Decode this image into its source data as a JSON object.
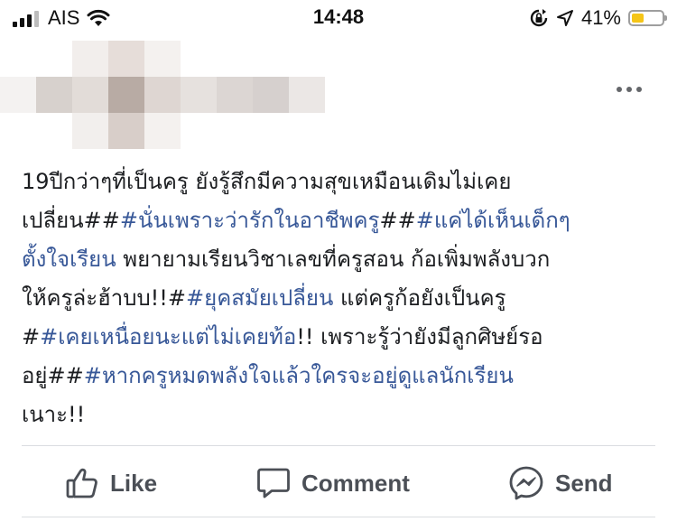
{
  "status_bar": {
    "carrier": "AIS",
    "time": "14:48",
    "battery_percent": "41%",
    "battery_level": 0.41,
    "signal_bars": 3,
    "signal_total": 4,
    "icons": [
      "signal-icon",
      "wifi-icon",
      "rotation-lock-icon",
      "location-arrow-icon",
      "battery-icon"
    ],
    "battery_color": "#f5c518"
  },
  "post": {
    "author_avatar": "blurred",
    "more_icon": "more-horizontal-icon",
    "lines": [
      [
        {
          "text": "19ปีกว่าๆที่เป็นครู ยังรู้สึกมีความสุขเหมือนเดิมไม่เคย",
          "tag": false
        }
      ],
      [
        {
          "text": "เปลี่ยน##",
          "tag": false
        },
        {
          "text": "#นั่นเพราะว่ารักในอาชีพครู",
          "tag": true
        },
        {
          "text": "##",
          "tag": false
        },
        {
          "text": "#แค่ได้เห็นเด็กๆ",
          "tag": true
        }
      ],
      [
        {
          "text": "ตั้งใจเรียน",
          "tag": true
        },
        {
          "text": " พยายามเรียนวิชาเลขที่ครูสอน ก้อเพิ่มพลังบวก",
          "tag": false
        }
      ],
      [
        {
          "text": "ให้ครูล่ะฮ้าบบ!!#",
          "tag": false
        },
        {
          "text": "#ยุคสมัยเปลี่ยน",
          "tag": true
        },
        {
          "text": " แต่ครูก้อยังเป็นครู",
          "tag": false
        }
      ],
      [
        {
          "text": "#",
          "tag": false
        },
        {
          "text": "#เคยเหนื่อยนะแต่ไม่เคยท้อ",
          "tag": true
        },
        {
          "text": "!! เพราะรู้ว่ายังมีลูกศิษย์รอ",
          "tag": false
        }
      ],
      [
        {
          "text": "อยู่##",
          "tag": false
        },
        {
          "text": "#หากครูหมดพลังใจแล้วใครจะอยู่ดูแลนักเรียน",
          "tag": true
        }
      ],
      [
        {
          "text": "เนาะ!!",
          "tag": false
        }
      ]
    ],
    "hashtag_color": "#385898"
  },
  "actions": [
    {
      "label": "Like",
      "icon": "thumbs-up-icon"
    },
    {
      "label": "Comment",
      "icon": "comment-bubble-icon"
    },
    {
      "label": "Send",
      "icon": "messenger-icon"
    }
  ]
}
